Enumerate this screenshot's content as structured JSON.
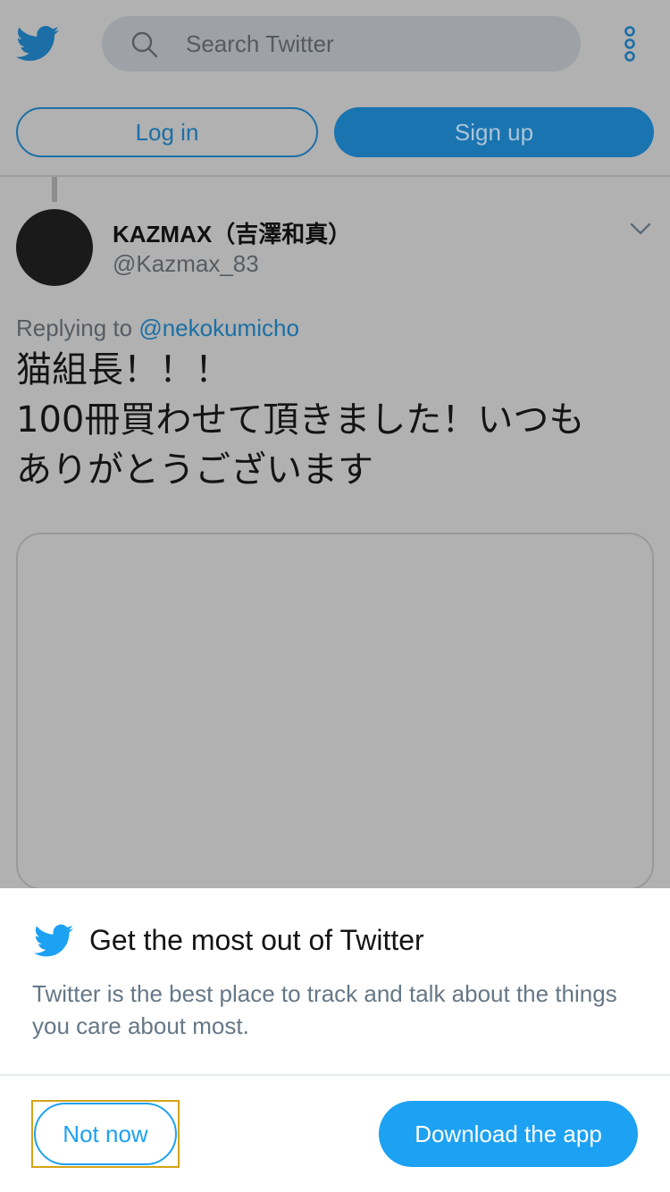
{
  "header": {
    "search_placeholder": "Search Twitter",
    "login_label": "Log in",
    "signup_label": "Sign up"
  },
  "tweet": {
    "author_name": "KAZMAX（吉澤和真）",
    "author_handle": "@Kazmax_83",
    "replying_prefix": "Replying to",
    "replying_to": "@nekokumicho",
    "text_lines": [
      "猫組長！！！",
      "100冊買わせて頂きました！いつも",
      "ありがとうございます"
    ]
  },
  "sheet": {
    "title": "Get the most out of Twitter",
    "description": "Twitter is the best place to track and talk about the things you care about most.",
    "not_now_label": "Not now",
    "download_label": "Download the app"
  },
  "colors": {
    "twitter_blue": "#1da1f2",
    "dim_overlay_bg": "#b1b1b1",
    "focus_ring": "#d4a316"
  },
  "icons": [
    "twitter-bird-icon",
    "search-icon",
    "more-vertical-icon",
    "chevron-down-icon"
  ]
}
